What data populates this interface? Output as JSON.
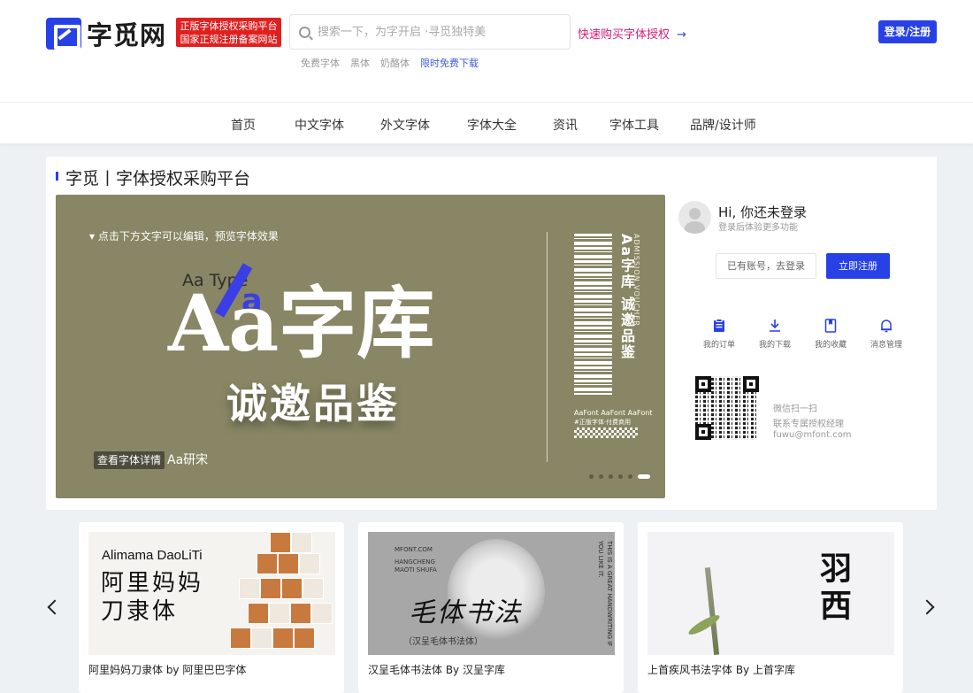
{
  "header": {
    "logo_text": "字觅网",
    "badge_line1": "正版字体授权采购平台",
    "badge_line2": "国家正规注册备案网站",
    "search_placeholder": "搜索一下，为字开启 ·寻觅独特美",
    "buy_link": "快速购买字体授权",
    "buy_arrow": "→",
    "hot_tags": [
      "免费字体",
      "黑体",
      "奶酪体"
    ],
    "free_tag": "限时免费下载",
    "login_button": "登录/注册"
  },
  "nav": {
    "items": [
      "首页",
      "中文字体",
      "外文字体",
      "字体大全",
      "资讯",
      "字体工具",
      "品牌/设计师"
    ]
  },
  "panel": {
    "title": "字觅丨字体授权采购平台"
  },
  "banner": {
    "hint": "▾ 点击下方文字可以编辑，预览字体效果",
    "type_small": "Aa Type",
    "a_small": "a",
    "big_text": "Aa字库",
    "sub_text": "诚邀品鉴",
    "detail_button": "查看字体详情",
    "font_name": "Aa研宋",
    "ticket_vertical_main": "Aa字库 诚邀品鉴",
    "ticket_vertical_en": "ADMISSION VOUCHER",
    "ticket_small1": "AaFont AaFont AaFont",
    "ticket_small2": "#正版字体·付费商用",
    "slide_count": 6,
    "active_slide": 6
  },
  "user": {
    "hello": "Hi, 你还未登录",
    "hello_sub": "登录后体验更多功能",
    "login_existing": "已有账号，去登录",
    "register": "立即注册",
    "quick_links": [
      {
        "label": "我的订单",
        "icon": "clipboard-icon"
      },
      {
        "label": "我的下载",
        "icon": "download-icon"
      },
      {
        "label": "我的收藏",
        "icon": "bookmark-icon"
      },
      {
        "label": "消息管理",
        "icon": "bell-icon"
      }
    ],
    "qr_line1": "微信扫一扫",
    "qr_line2": "联系专属授权经理",
    "qr_email": "fuwu@mfont.com"
  },
  "cards": [
    {
      "caption": "阿里妈妈刀隶体 by 阿里巴巴字体",
      "title_en": "Alimama DaoLiTi",
      "title_cn_1": "阿里妈妈",
      "title_cn_2": "刀隶体"
    },
    {
      "caption": "汉呈毛体书法体 By 汉呈字库",
      "small_1": "MFONT.COM",
      "small_2": "HANGCHENG",
      "small_3": "MAOTI SHUFA",
      "big": "毛体书法",
      "sub": "（汉呈毛体书法体）",
      "vert": "THIS IS A GREAT HANDWRITING IF YOU LIKE IT."
    },
    {
      "caption": "上首疾风书法字体 By 上首字库",
      "big": "羽西"
    }
  ],
  "colors": {
    "brand_blue": "#2741e7",
    "badge_red": "#e02020",
    "link_pink": "#d91b76",
    "banner_olive": "#888664"
  }
}
